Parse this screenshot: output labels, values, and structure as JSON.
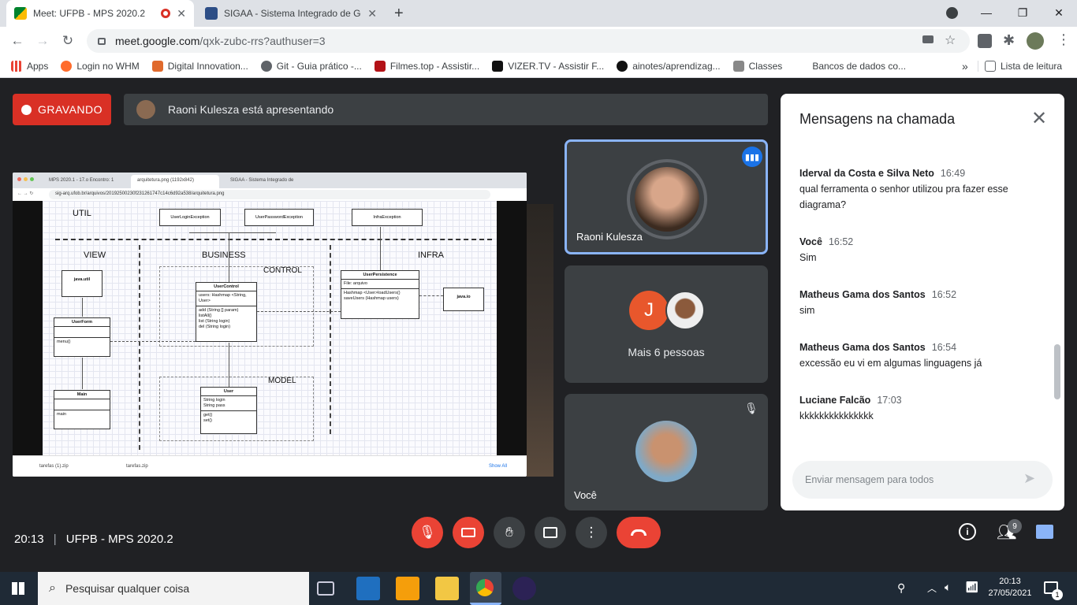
{
  "browser": {
    "tabs": [
      {
        "title": "Meet: UFPB - MPS 2020.2",
        "active": true,
        "recording": true
      },
      {
        "title": "SIGAA - Sistema Integrado de Ge",
        "active": false
      }
    ],
    "new_tab": "+",
    "url_host": "meet.google.com",
    "url_path": "/qxk-zubc-rrs?authuser=3",
    "bookmarks": [
      "Apps",
      "Login no WHM",
      "Digital Innovation...",
      "Git - Guia prático -...",
      "Filmes.top - Assistir...",
      "VIZER.TV - Assistir F...",
      "ainotes/aprendizag...",
      "Classes",
      "Bancos de dados co..."
    ],
    "bookmarks_more": "»",
    "reading_list": "Lista de leitura"
  },
  "meet": {
    "recording_label": "GRAVANDO",
    "presenting_text": "Raoni Kulesza está apresentando",
    "shared_screen": {
      "tabs": [
        "MPS 2020.1 - 17.o Encontro: 1",
        "arquitetura.png (1192x842)",
        "SIGAA - Sistema Integrado de"
      ],
      "url": "sig-arq.ufob.br/arquivos/20192500230f231261747c14c6d92a538/arquitetura.png",
      "layers": {
        "util": "UTIL",
        "view": "VIEW",
        "business": "BUSINESS",
        "infra": "INFRA",
        "control": "CONTROL",
        "model": "MODEL"
      },
      "exceptions": [
        "UserLoginException",
        "UserPasswordException",
        "InfraException"
      ],
      "classes": {
        "java_util": "java.util",
        "java_io": "java.io",
        "user_form": {
          "name": "UserForm",
          "methods": "menu()"
        },
        "main": {
          "name": "Main",
          "methods": "main"
        },
        "user_control": {
          "name": "UserControl",
          "attrs": "users: Hashmap <String, User>",
          "methods": [
            "add (String [] param)",
            "listAll()",
            "list (String login)",
            "del (String login)"
          ]
        },
        "user": {
          "name": "User",
          "attrs": [
            "String login",
            "String pass"
          ],
          "methods": [
            "get()",
            "set()"
          ]
        },
        "user_persistence": {
          "name": "UserPersistence",
          "attrs": "File: arquivo",
          "methods": [
            "Hashmap <User>loadUsers()",
            "saveUsers (Hashmap users)"
          ]
        }
      },
      "downloads": [
        "tarefas (1).zip",
        "tarefas.zip"
      ],
      "show_all": "Show All"
    },
    "participants": [
      {
        "name": "Raoni Kulesza",
        "speaking": true
      },
      {
        "name": "Mais 6 pessoas",
        "initial": "J"
      },
      {
        "name": "Você",
        "muted": true
      }
    ],
    "chat": {
      "title": "Mensagens na chamada",
      "messages": [
        {
          "sender": "Iderval da Costa e Silva Neto",
          "time": "16:49",
          "text": "qual ferramenta o senhor utilizou pra fazer esse diagrama?"
        },
        {
          "sender": "Você",
          "time": "16:52",
          "text": "Sim"
        },
        {
          "sender": "Matheus Gama dos Santos",
          "time": "16:52",
          "text": "sim"
        },
        {
          "sender": "Matheus Gama dos Santos",
          "time": "16:54",
          "text": "excessão eu vi em algumas linguagens já"
        },
        {
          "sender": "Luciane Falcão",
          "time": "17:03",
          "text": "kkkkkkkkkkkkkkk"
        }
      ],
      "input_placeholder": "Enviar mensagem para todos"
    },
    "meeting_time": "20:13",
    "meeting_separator": "|",
    "meeting_name": "UFPB - MPS 2020.2",
    "participant_count": "9"
  },
  "taskbar": {
    "search_placeholder": "Pesquisar qualquer coisa",
    "time": "20:13",
    "date": "27/05/2021",
    "notification_count": "1"
  },
  "colors": {
    "record_red": "#d93025",
    "meet_bg": "#202124",
    "tile_bg": "#3c4043",
    "accent_blue": "#8ab4f8",
    "hangup": "#ea4335"
  }
}
